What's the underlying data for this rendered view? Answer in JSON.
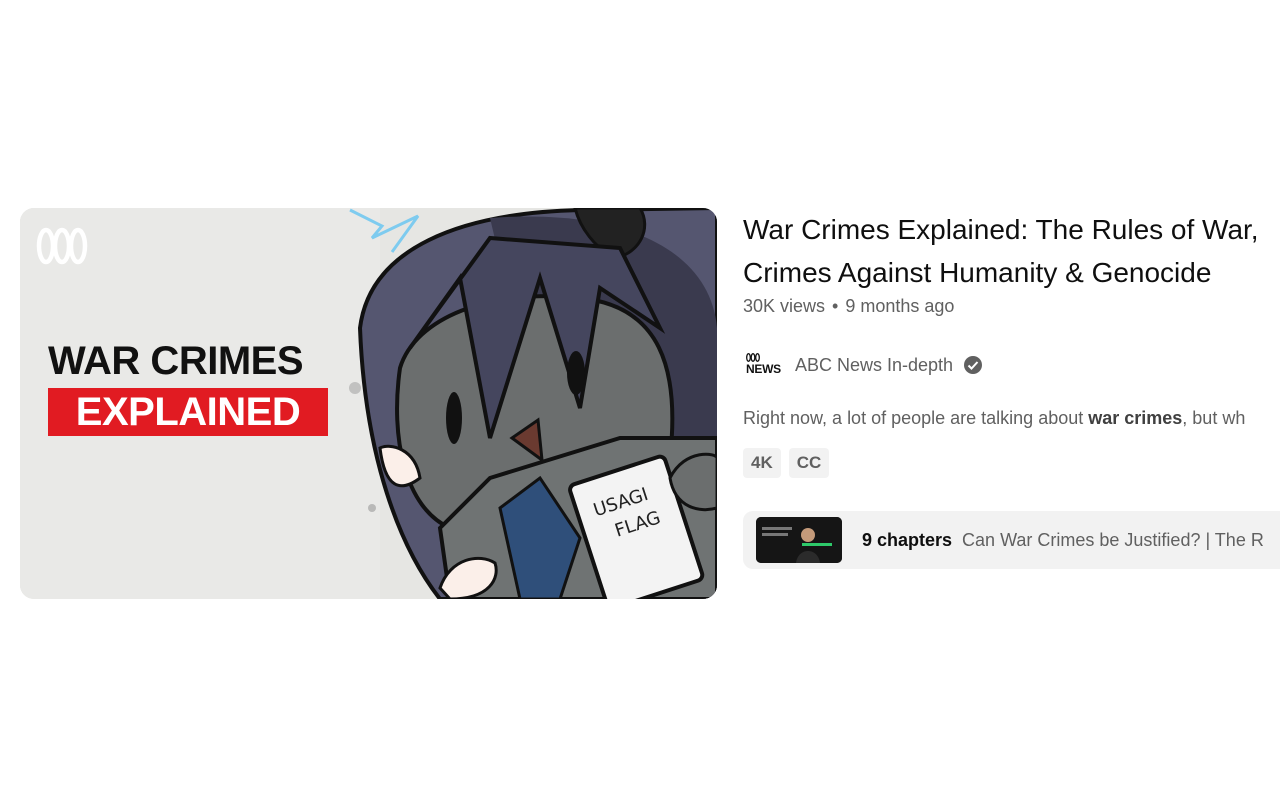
{
  "thumbnail": {
    "headline_line1": "WAR CRIMES",
    "headline_line2": "EXPLAINED",
    "card_text_1": "USAGI",
    "card_text_2": "FLAG",
    "accent_color": "#e11b22"
  },
  "video": {
    "title_line1": "War Crimes Explained: The Rules of War,",
    "title_line2": "Crimes Against Humanity & Genocide",
    "views": "30K views",
    "separator": "•",
    "age": "9 months ago"
  },
  "channel": {
    "logo_text": "NEWS",
    "name": "ABC News In-depth",
    "verified_icon": "verified-check-icon"
  },
  "description": {
    "before": "Right now, a lot of people are talking about ",
    "bold": "war crimes",
    "after": ", but wh"
  },
  "badges": [
    "4K",
    "CC"
  ],
  "chapters": {
    "count": "9 chapters",
    "first_title": "Can War Crimes be Justified? | The R"
  }
}
